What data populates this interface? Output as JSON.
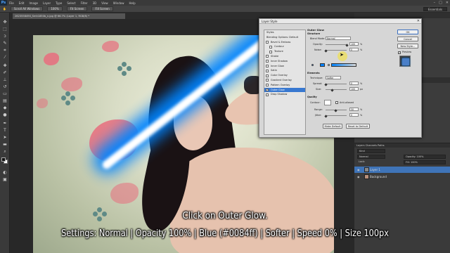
{
  "menubar": {
    "logo": "Ps",
    "items": [
      "File",
      "Edit",
      "Image",
      "Layer",
      "Type",
      "Select",
      "Filter",
      "3D",
      "View",
      "Window",
      "Help"
    ],
    "window_controls": [
      "–",
      "□",
      "✕"
    ]
  },
  "options_bar": {
    "buttons": [
      "Scroll All Windows",
      "100%",
      "Fit Screen",
      "Fill Screen"
    ],
    "workspace": "Essentials"
  },
  "document_tab": {
    "title": "2623558490_Smh1850b_n.jpg @ 66.7% (Layer 1, RGB/8) *"
  },
  "dialog": {
    "title": "Layer Style",
    "styles": [
      {
        "label": "Styles",
        "header": true
      },
      {
        "label": "Blending Options: Default",
        "header": true
      },
      {
        "label": "Bevel & Emboss",
        "checked": false
      },
      {
        "label": "Contour",
        "checked": false,
        "indent": true
      },
      {
        "label": "Texture",
        "checked": false,
        "indent": true
      },
      {
        "label": "Stroke",
        "checked": false
      },
      {
        "label": "Inner Shadow",
        "checked": false
      },
      {
        "label": "Inner Glow",
        "checked": false
      },
      {
        "label": "Satin",
        "checked": false
      },
      {
        "label": "Color Overlay",
        "checked": false
      },
      {
        "label": "Gradient Overlay",
        "checked": false
      },
      {
        "label": "Pattern Overlay",
        "checked": false
      },
      {
        "label": "Outer Glow",
        "checked": true,
        "selected": true
      },
      {
        "label": "Drop Shadow",
        "checked": false
      }
    ],
    "outer_glow": {
      "title": "Outer Glow",
      "structure_label": "Structure",
      "blend_mode_label": "Blend Mode:",
      "blend_mode": "Normal",
      "opacity_label": "Opacity:",
      "opacity": "100",
      "noise_label": "Noise:",
      "noise": "0",
      "percent": "%",
      "elements_label": "Elements",
      "technique_label": "Technique:",
      "technique": "Softer",
      "spread_label": "Spread:",
      "spread": "0",
      "size_label": "Size:",
      "size": "100",
      "px": "px",
      "quality_label": "Quality",
      "contour_label": "Contour:",
      "antialiased_label": "Anti-aliased",
      "range_label": "Range:",
      "range": "50",
      "jitter_label": "Jitter:",
      "jitter": "0",
      "make_default": "Make Default",
      "reset_default": "Reset to Default"
    },
    "buttons": {
      "ok": "OK",
      "cancel": "Cancel",
      "new_style": "New Style...",
      "preview": "Preview"
    },
    "glow_color": "#0084ff"
  },
  "layers": {
    "tabs": "Layers   Channels   Paths",
    "kind_label": "Kind",
    "blend_mode": "Normal",
    "opacity_label": "Opacity: 100%",
    "lock_label": "Lock:",
    "fill_label": "Fill: 100%",
    "items": [
      {
        "name": "Layer 1",
        "active": true
      },
      {
        "name": "Background",
        "active": false
      }
    ]
  },
  "captions": {
    "line1": "Click on Outer Glow.",
    "line2": "Settings: Normal  |  Opacity 100%  |  Blue (#0084ff)  |  Softer  |  Speed 0%  |  Size 100px"
  }
}
